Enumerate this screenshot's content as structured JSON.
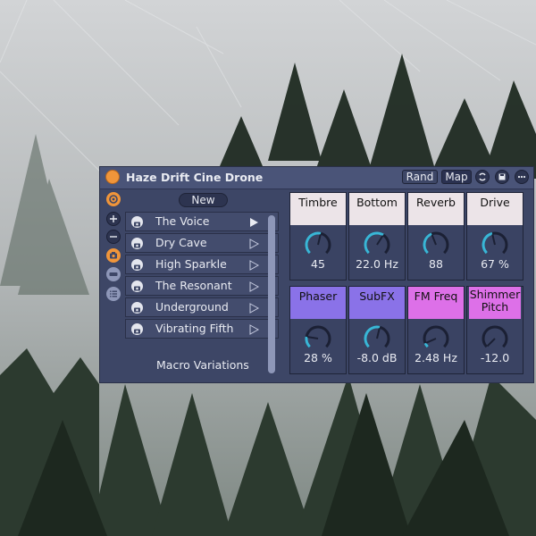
{
  "device": {
    "title": "Haze Drift Cine Drone",
    "rand_label": "Rand",
    "map_label": "Map",
    "accent": "#f0953a"
  },
  "sidebar_icons": [
    "power-orange-icon",
    "plus-icon",
    "minus-icon",
    "camera-orange-icon",
    "minus-bar-icon",
    "list-icon"
  ],
  "variations": {
    "new_label": "New",
    "items": [
      {
        "label": "The Voice",
        "active": true
      },
      {
        "label": "Dry Cave",
        "active": false
      },
      {
        "label": "High Sparkle",
        "active": false
      },
      {
        "label": "The Resonant",
        "active": false
      },
      {
        "label": "Underground",
        "active": false
      },
      {
        "label": "Vibrating Fifth",
        "active": false
      }
    ],
    "footer_label": "Macro Variations"
  },
  "macros": [
    {
      "name": "Timbre",
      "value": "45",
      "fill": 0.55,
      "head_color": "#ece4e8",
      "text_color": "#111111"
    },
    {
      "name": "Bottom",
      "value": "22.0 Hz",
      "fill": 0.62,
      "head_color": "#ece4e8",
      "text_color": "#111111"
    },
    {
      "name": "Reverb",
      "value": "88",
      "fill": 0.42,
      "head_color": "#ece4e8",
      "text_color": "#111111"
    },
    {
      "name": "Drive",
      "value": "67 %",
      "fill": 0.45,
      "head_color": "#ece4e8",
      "text_color": "#111111"
    },
    {
      "name": "Phaser",
      "value": "28 %",
      "fill": 0.2,
      "head_color": "#8a72e8",
      "text_color": "#111111"
    },
    {
      "name": "SubFX",
      "value": "-8.0 dB",
      "fill": 0.55,
      "head_color": "#8a72e8",
      "text_color": "#111111"
    },
    {
      "name": "FM Freq",
      "value": "2.48 Hz",
      "fill": 0.08,
      "head_color": "#dd70e8",
      "text_color": "#111111"
    },
    {
      "name": "Shimmer Pitch",
      "value": "-12.0",
      "fill": 0.0,
      "head_color": "#dd70e8",
      "text_color": "#111111"
    }
  ],
  "colors": {
    "knob_active": "#39b6d6",
    "knob_track": "#1b2034",
    "panel": "#3d4666"
  }
}
